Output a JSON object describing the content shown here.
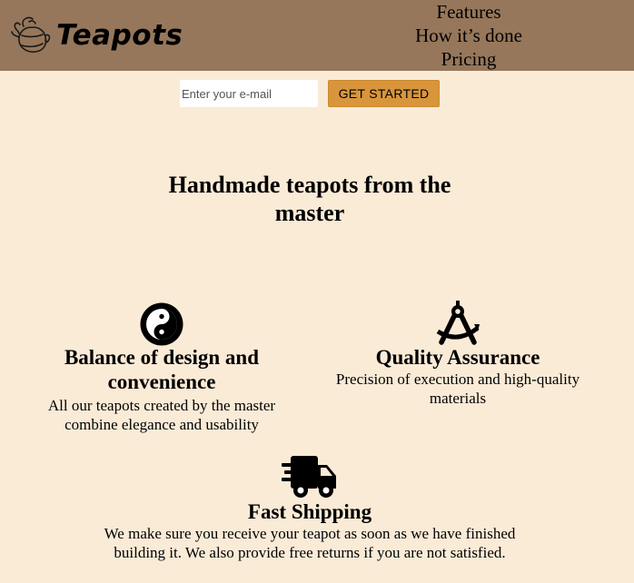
{
  "header": {
    "logo_icon": "teapot-icon",
    "logo_text": "Teapots",
    "nav": [
      "Features",
      "How it’s done",
      "Pricing"
    ]
  },
  "signup": {
    "email_placeholder": "Enter your e-mail",
    "button_label": "GET STARTED"
  },
  "hero": {
    "title": "Handmade teapots from the master"
  },
  "features": [
    {
      "icon": "yin-yang-icon",
      "title": "Balance of design and convenience",
      "text": "All our teapots created by the master combine elegance and usability"
    },
    {
      "icon": "drafting-compass-icon",
      "title": "Quality Assurance",
      "text": "Precision of execution and high-quality materials"
    },
    {
      "icon": "shipping-truck-icon",
      "title": "Fast Shipping",
      "text": "We make sure you receive your teapot as soon as we have finished building it. We also provide free returns if you are not satisfied."
    }
  ],
  "colors": {
    "page_background": "#faebd7",
    "header_background": "#96775b",
    "button_background": "#d9953b"
  }
}
